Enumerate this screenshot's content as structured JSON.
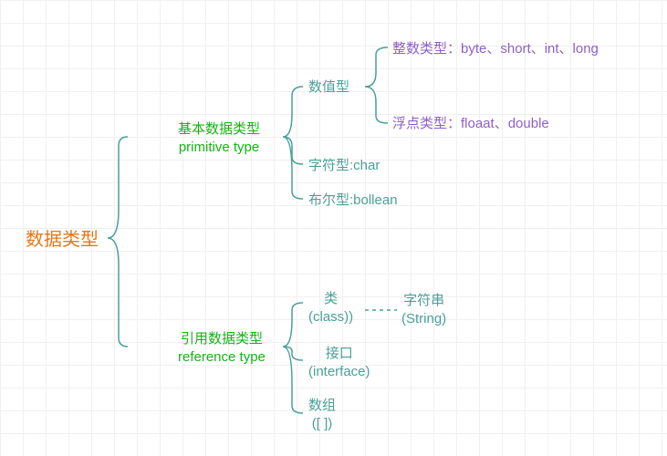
{
  "chart_data": {
    "type": "tree",
    "root": "数据类型",
    "children": [
      {
        "label_cn": "基本数据类型",
        "label_en": "primitive type",
        "children": [
          {
            "label": "数值型",
            "children": [
              {
                "label": "整数类型：byte、short、int、long"
              },
              {
                "label": "浮点类型：floaat、double"
              }
            ]
          },
          {
            "label": "字符型:char"
          },
          {
            "label": "布尔型:bollean"
          }
        ]
      },
      {
        "label_cn": "引用数据类型",
        "label_en": "reference type",
        "children": [
          {
            "label_cn": "类",
            "label_en": "(class))",
            "link": {
              "label_cn": "字符串",
              "label_en": "(String)"
            }
          },
          {
            "label_cn": "接口",
            "label_en": "(interface)"
          },
          {
            "label_cn": "数组",
            "label_en": "([ ])"
          }
        ]
      }
    ]
  },
  "root": "数据类型",
  "primitive_cn": "基本数据类型",
  "primitive_en": "primitive type",
  "numeric": "数值型",
  "integer": "整数类型：byte、short、int、long",
  "float": "浮点类型：floaat、double",
  "char": "字符型:char",
  "bool": "布尔型:bollean",
  "reference_cn": "引用数据类型",
  "reference_en": "reference type",
  "class_cn": "类",
  "class_en": "(class))",
  "string_cn": "字符串",
  "string_en": "(String)",
  "interface_cn": "接口",
  "interface_en": "(interface)",
  "array_cn": "数组",
  "array_en": "([ ])"
}
